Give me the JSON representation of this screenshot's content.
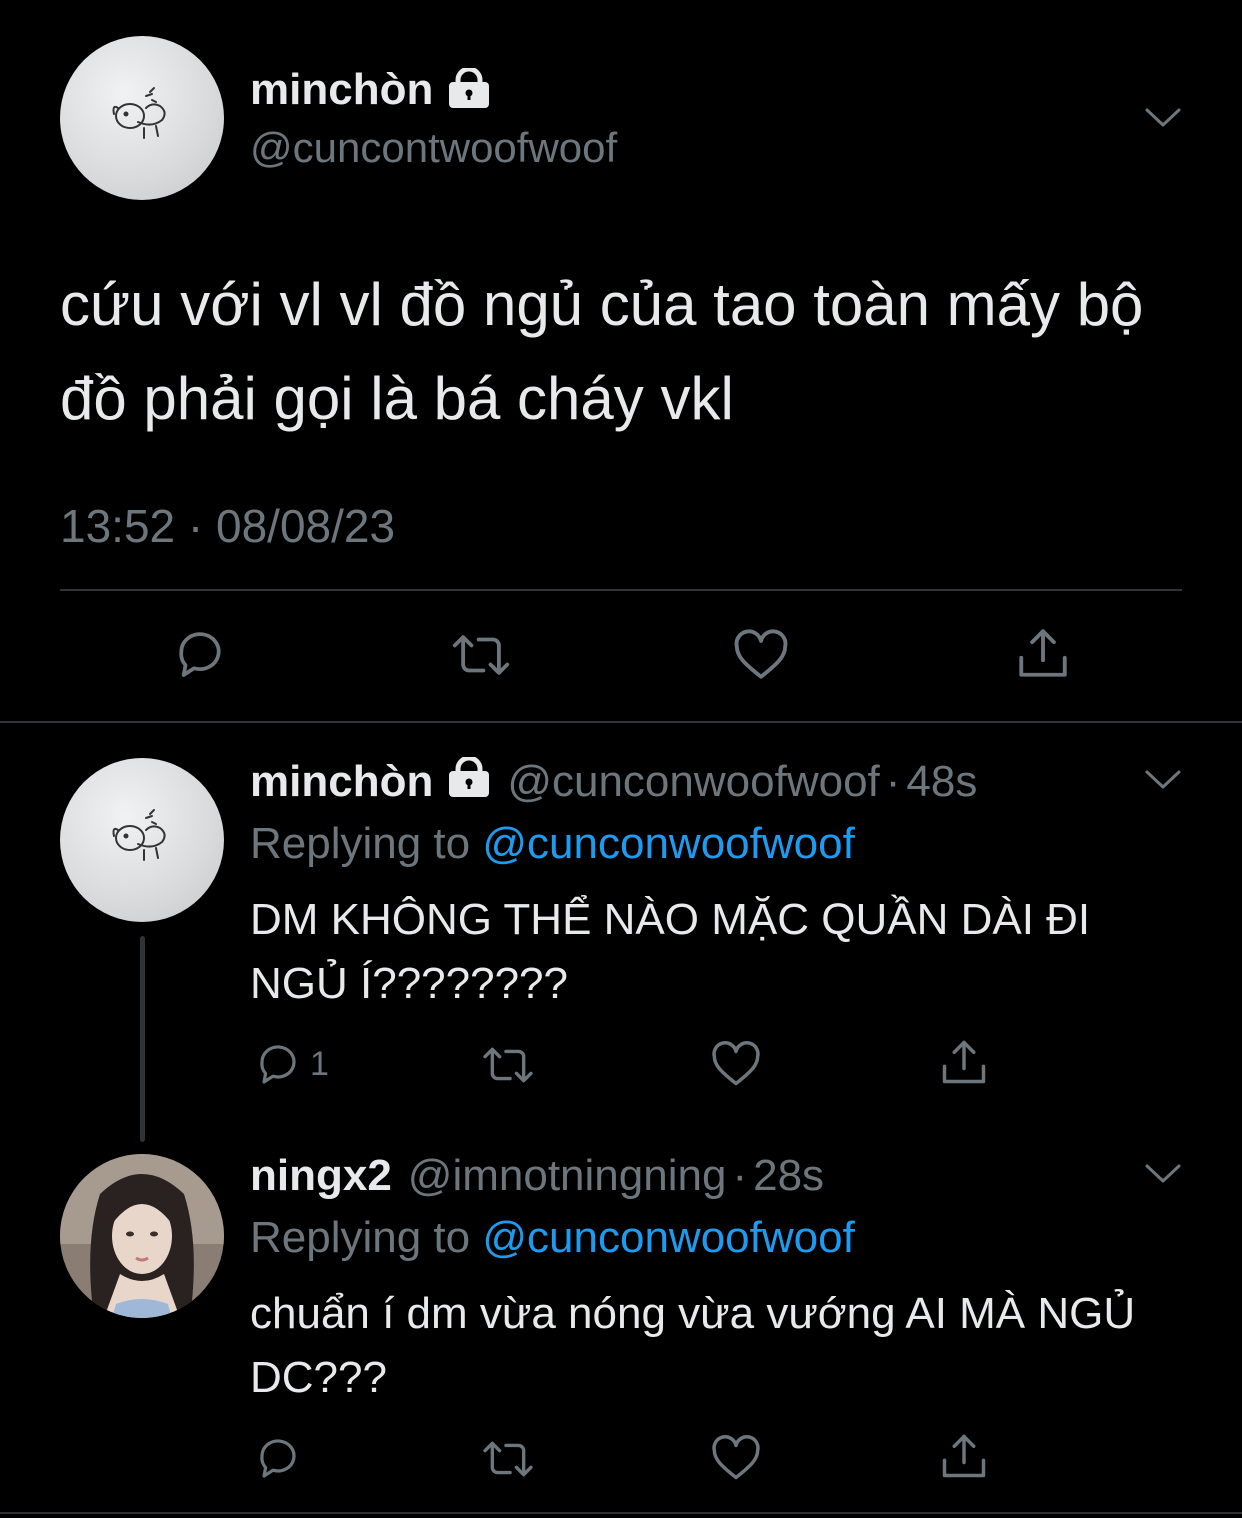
{
  "main_tweet": {
    "display_name": "minchòn",
    "handle": "@cuncontwoofwoof",
    "text": "cứu với vl vl đồ ngủ của tao toàn mấy bộ đồ phải gọi là bá cháy vkl",
    "timestamp": "13:52 · 08/08/23"
  },
  "replies": [
    {
      "display_name": "minchòn",
      "handle": "@cunconwoofwoof",
      "time": "48s",
      "replying_label": "Replying to",
      "replying_to": "@cunconwoofwoof",
      "text": "DM KHÔNG THỂ NÀO MẶC QUẦN DÀI ĐI NGỦ Í????????",
      "reply_count": "1"
    },
    {
      "display_name": "ningx2",
      "handle": "@imnotningning",
      "time": "28s",
      "replying_label": "Replying to",
      "replying_to": "@cunconwoofwoof",
      "text": "chuẩn í dm vừa nóng vừa vướng AI MÀ NGỦ DC???",
      "reply_count": ""
    }
  ],
  "separator": "·",
  "icons": [
    "lock-icon",
    "chevron-down-icon",
    "reply-icon",
    "retweet-icon",
    "like-icon",
    "share-icon"
  ],
  "colors": {
    "background": "#000000",
    "text": "#e7e9ea",
    "muted": "#6e767d",
    "link": "#1d9bf0"
  }
}
